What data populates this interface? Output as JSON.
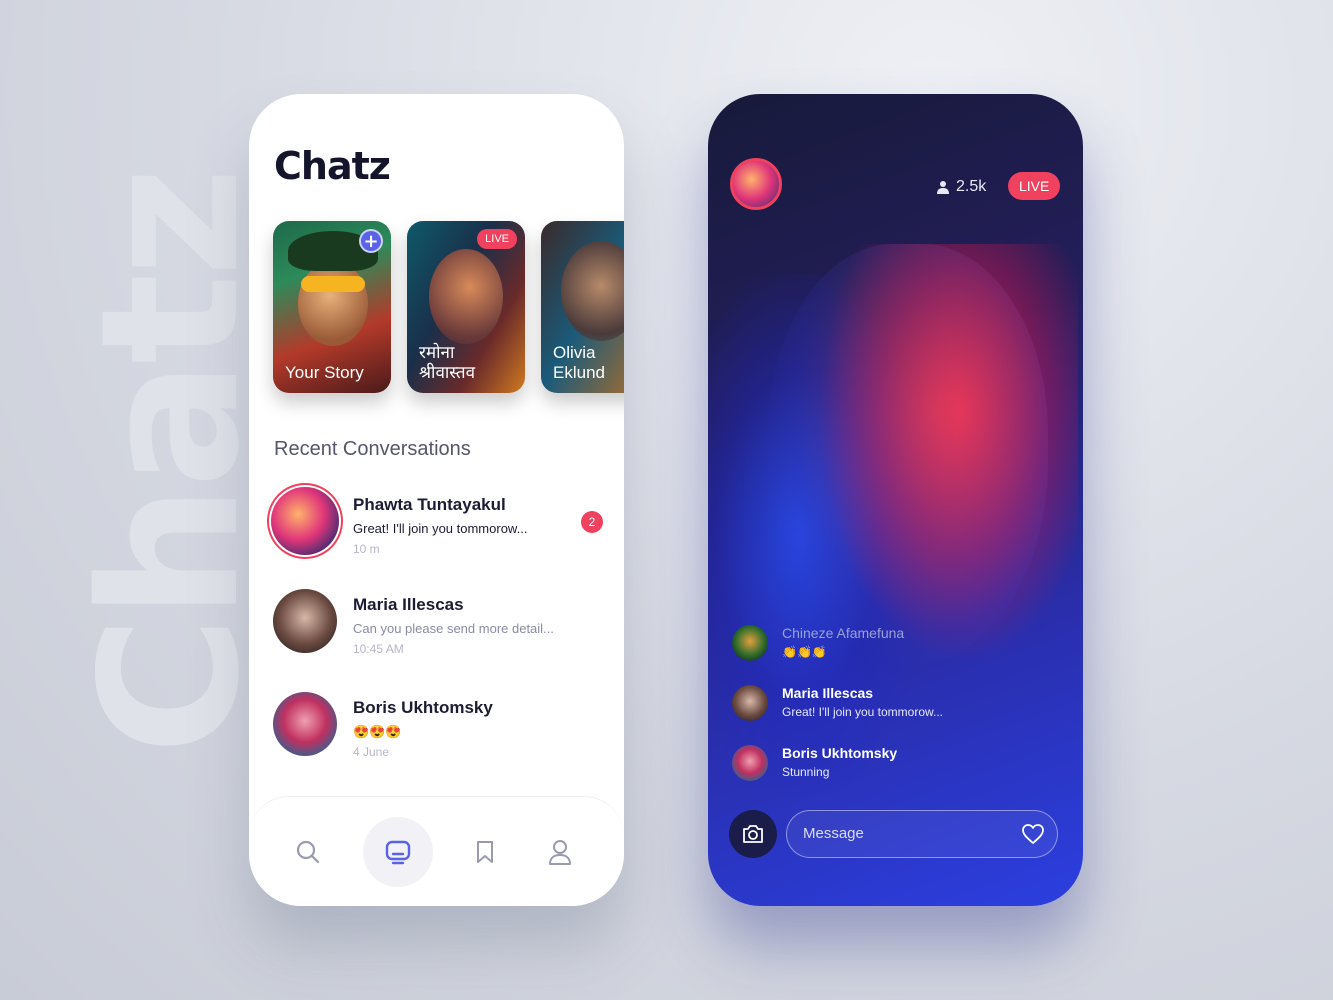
{
  "background_word": "Chatz",
  "left": {
    "title": "Chatz",
    "stories": [
      {
        "label": "Your Story",
        "badge": "+"
      },
      {
        "label": "रमोना श्रीवास्तव",
        "badge": "LIVE"
      },
      {
        "label": "Olivia Eklund",
        "badge": ""
      }
    ],
    "section_title": "Recent Conversations",
    "conversations": [
      {
        "name": "Phawta Tuntayakul",
        "message": "Great! I'll join you tommorow...",
        "time": "10 m",
        "unread": "2"
      },
      {
        "name": "Maria Illescas",
        "message": "Can you please send more detail...",
        "time": "10:45 AM"
      },
      {
        "name": "Boris Ukhtomsky",
        "message": "😍😍😍",
        "time": "4 June"
      }
    ],
    "nav": [
      "search-icon",
      "chat-icon",
      "bookmark-icon",
      "profile-icon"
    ]
  },
  "right": {
    "viewers": "2.5k",
    "live": "LIVE",
    "comments": [
      {
        "name": "Chineze Afamefuna",
        "text": "👏👏👏"
      },
      {
        "name": "Maria Illescas",
        "text": "Great! I'll join you tommorow..."
      },
      {
        "name": "Boris Ukhtomsky",
        "text": "Stunning"
      }
    ],
    "message_placeholder": "Message"
  },
  "colors": {
    "accent": "#5a63e8",
    "live": "#f0415e",
    "dark": "#14142b"
  }
}
